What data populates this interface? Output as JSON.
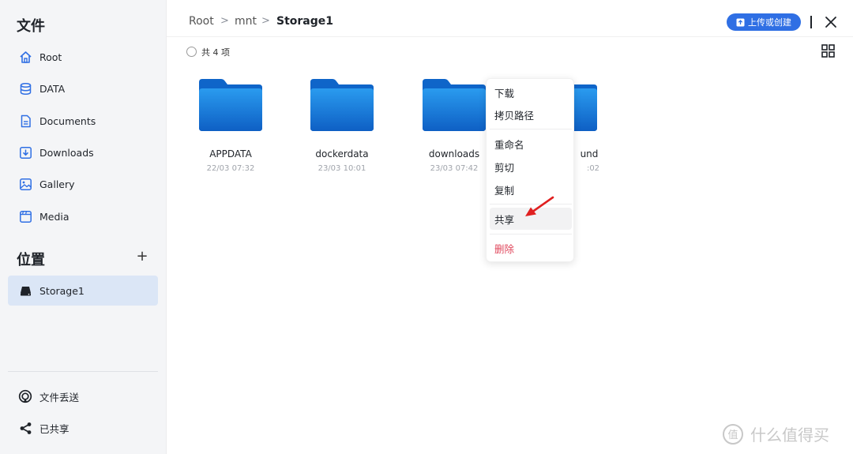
{
  "sidebar": {
    "files_title": "文件",
    "items": [
      {
        "label": "Root",
        "icon": "home-icon"
      },
      {
        "label": "DATA",
        "icon": "database-icon"
      },
      {
        "label": "Documents",
        "icon": "document-icon"
      },
      {
        "label": "Downloads",
        "icon": "download-icon"
      },
      {
        "label": "Gallery",
        "icon": "image-icon"
      },
      {
        "label": "Media",
        "icon": "media-icon"
      }
    ],
    "location_title": "位置",
    "location_add": "+",
    "locations": [
      {
        "label": "Storage1",
        "icon": "drive-icon",
        "active": true
      }
    ],
    "bottom": [
      {
        "label": "文件丢送",
        "icon": "airdrop-icon"
      },
      {
        "label": "已共享",
        "icon": "share-icon"
      }
    ]
  },
  "header": {
    "breadcrumb": [
      "Root",
      "mnt",
      "Storage1"
    ],
    "separator": ">",
    "upload_label": "上传或创建"
  },
  "toolbar": {
    "count_text": "共 4 项"
  },
  "folders": [
    {
      "name": "APPDATA",
      "date": "22/03 07:32"
    },
    {
      "name": "dockerdata",
      "date": "23/03 10:01"
    },
    {
      "name": "downloads",
      "date": "23/03 07:42"
    },
    {
      "name": "und",
      "date": ":02"
    }
  ],
  "context_menu": {
    "items": [
      {
        "label": "下载"
      },
      {
        "label": "拷贝路径"
      },
      {
        "label": "重命名"
      },
      {
        "label": "剪切"
      },
      {
        "label": "复制"
      },
      {
        "label": "共享"
      },
      {
        "label": "删除"
      }
    ]
  },
  "watermark": {
    "text": "什么值得买"
  },
  "colors": {
    "accent": "#2f6fe4",
    "folder_top": "#1f8ae6",
    "folder_bottom": "#0f62c6",
    "danger": "#e0475c",
    "arrow": "#e02020",
    "active_bg": "#dbe6f6"
  }
}
